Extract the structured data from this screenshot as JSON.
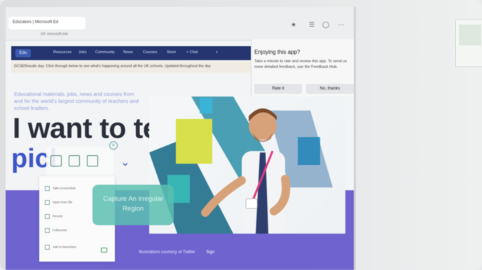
{
  "browser": {
    "tab_title": "Educators | Microsoft Ed",
    "address": "Url: microsoft.edu"
  },
  "site": {
    "logo": "Edu",
    "nav": [
      "Resources",
      "Jobs",
      "Community",
      "News",
      "Courses",
      "Store",
      "+ Chat"
    ],
    "banner": "GCSEResults day: Click through below to see what's happening around all the UK schools. Updated throughout the day",
    "hero_intro": "Educational materials, jobs, news and courses from and for the world's largest community of teachers and school leaders.",
    "hero_title": "I want to teach",
    "hero_sub": "picl",
    "footer_text": "Illustrations courtesy of Twitter",
    "footer_link": "Sign"
  },
  "popup": {
    "title": "Enjoying this app?",
    "body": "Take a minute to rate and review this app. To send us more detailed feedback, use the Feedback Hub.",
    "rate_label": "Rate it",
    "decline_label": "No, thanks"
  },
  "snip": {
    "menu_items": [
      "Take screenshot",
      "Open from file",
      "Recent",
      "Fullscreen",
      "Add to favourites"
    ],
    "tooltip": "Capture An Irregular Region"
  },
  "colors": {
    "nav": "#24356f",
    "accent_blue": "#3f56c9",
    "band": "#6f63cf",
    "tooltip": "#5cbeb0"
  }
}
